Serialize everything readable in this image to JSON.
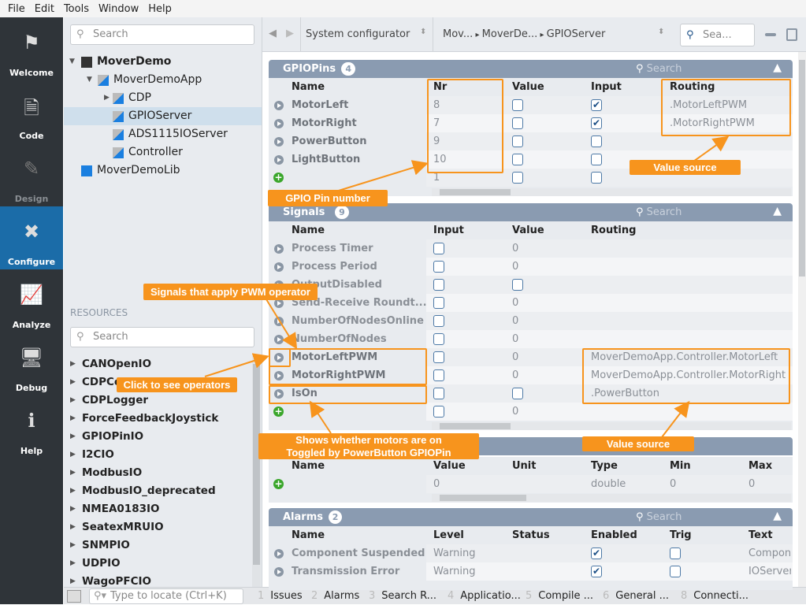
{
  "menu": [
    "File",
    "Edit",
    "Tools",
    "Window",
    "Help"
  ],
  "nav": [
    {
      "label": "Welcome",
      "icon": "flag-icon",
      "glyph": "⚑"
    },
    {
      "label": "Code",
      "icon": "document-icon",
      "glyph": "🗎"
    },
    {
      "label": "Design",
      "icon": "design-icon",
      "glyph": "✎"
    },
    {
      "label": "Configure",
      "icon": "tools-icon",
      "glyph": "✖"
    },
    {
      "label": "Analyze",
      "icon": "chart-monitor-icon",
      "glyph": "📈"
    },
    {
      "label": "Debug",
      "icon": "debug-icon",
      "glyph": "🖥"
    },
    {
      "label": "Help",
      "icon": "info-icon",
      "glyph": "ℹ"
    }
  ],
  "active_nav": "Configure",
  "tree": {
    "search_placeholder": "Search",
    "items": [
      {
        "label": "MoverDemo",
        "level": 0,
        "bold": true,
        "expander": "down"
      },
      {
        "label": "MoverDemoApp",
        "level": 1,
        "expander": "down"
      },
      {
        "label": "CDP",
        "level": 2,
        "expander": "right"
      },
      {
        "label": "GPIOServer",
        "level": 2,
        "selected": true
      },
      {
        "label": "ADS1115IOServer",
        "level": 2
      },
      {
        "label": "Controller",
        "level": 2
      },
      {
        "label": "MoverDemoLib",
        "level": 0
      }
    ]
  },
  "resources": {
    "label": "RESOURCES",
    "search_placeholder": "Search",
    "items": [
      "CANOpenIO",
      "CDPComm",
      "CDPLogger",
      "ForceFeedbackJoystick",
      "GPIOPinIO",
      "I2CIO",
      "ModbusIO",
      "ModbusIO_deprecated",
      "NMEA0183IO",
      "SeatexMRUIO",
      "SNMPIO",
      "UDPIO",
      "WagoPFCIO"
    ]
  },
  "locate_placeholder": "Type to locate (Ctrl+K)",
  "bottom_tabs": [
    {
      "n": "1",
      "label": "Issues"
    },
    {
      "n": "2",
      "label": "Alarms"
    },
    {
      "n": "3",
      "label": "Search R..."
    },
    {
      "n": "4",
      "label": "Applicatio..."
    },
    {
      "n": "5",
      "label": "Compile ..."
    },
    {
      "n": "6",
      "label": "General ..."
    },
    {
      "n": "8",
      "label": "Connecti..."
    }
  ],
  "toolbar": {
    "mode": "System configurator",
    "breadcrumb": [
      "Mov...",
      "MoverDe...",
      "GPIOServer"
    ],
    "search_placeholder": "Sea..."
  },
  "panels": {
    "gpiopins": {
      "title": "GPIOPins",
      "count": "4",
      "search": "Search",
      "columns": [
        "Name",
        "Nr",
        "Value",
        "Input",
        "Routing"
      ],
      "rows": [
        [
          "MotorLeft",
          "8",
          false,
          true,
          ".MotorLeftPWM"
        ],
        [
          "MotorRight",
          "7",
          false,
          true,
          ".MotorRightPWM"
        ],
        [
          "PowerButton",
          "9",
          false,
          false,
          ""
        ],
        [
          "LightButton",
          "10",
          false,
          false,
          ""
        ]
      ],
      "new_row": [
        "",
        "1",
        false,
        false,
        ""
      ]
    },
    "signals": {
      "title": "Signals",
      "count": "9",
      "search": "Search",
      "columns": [
        "Name",
        "Input",
        "Value",
        "Routing"
      ],
      "rows": [
        [
          "Process Timer",
          false,
          "0",
          ""
        ],
        [
          "Process Period",
          false,
          "0",
          ""
        ],
        [
          "OutputDisabled",
          false,
          false,
          ""
        ],
        [
          "Send-Receive Roundt...",
          false,
          "0",
          ""
        ],
        [
          "NumberOfNodesOnline",
          false,
          "0",
          ""
        ],
        [
          "NumberOfNodes",
          false,
          "0",
          ""
        ],
        [
          "MotorLeftPWM",
          false,
          "0",
          "MoverDemoApp.Controller.MotorLeft"
        ],
        [
          "MotorRightPWM",
          false,
          "0",
          "MoverDemoApp.Controller.MotorRight"
        ],
        [
          "IsOn",
          false,
          false,
          ".PowerButton"
        ]
      ],
      "new_row": [
        "",
        false,
        "0",
        ""
      ]
    },
    "parameters": {
      "columns": [
        "Name",
        "Value",
        "Unit",
        "Type",
        "Min",
        "Max"
      ],
      "new_row": [
        "",
        "0",
        "",
        "double",
        "0",
        "0"
      ]
    },
    "alarms": {
      "title": "Alarms",
      "count": "2",
      "search": "Search",
      "columns": [
        "Name",
        "Level",
        "Status",
        "Enabled",
        "Trig",
        "Text"
      ],
      "rows": [
        [
          "Component Suspended",
          "Warning",
          "",
          true,
          false,
          "Compone"
        ],
        [
          "Transmission Error",
          "Warning",
          "",
          true,
          false,
          "IOServer"
        ]
      ]
    }
  },
  "annotations": {
    "gpio_pin_number": "GPIO Pin number",
    "value_source_1": "Value source",
    "pwm_signals": "Signals that apply PWM operator",
    "click_operators": "Click to see operators",
    "motors_on": [
      "Shows whether motors are on",
      "Toggled by PowerButton GPIOPin"
    ],
    "value_source_2": "Value source"
  },
  "colors": {
    "accent": "#f7941d",
    "nav_active": "#1b6ca8",
    "panel_header": "#8a9bb1",
    "nav_bg": "#2f3439"
  }
}
